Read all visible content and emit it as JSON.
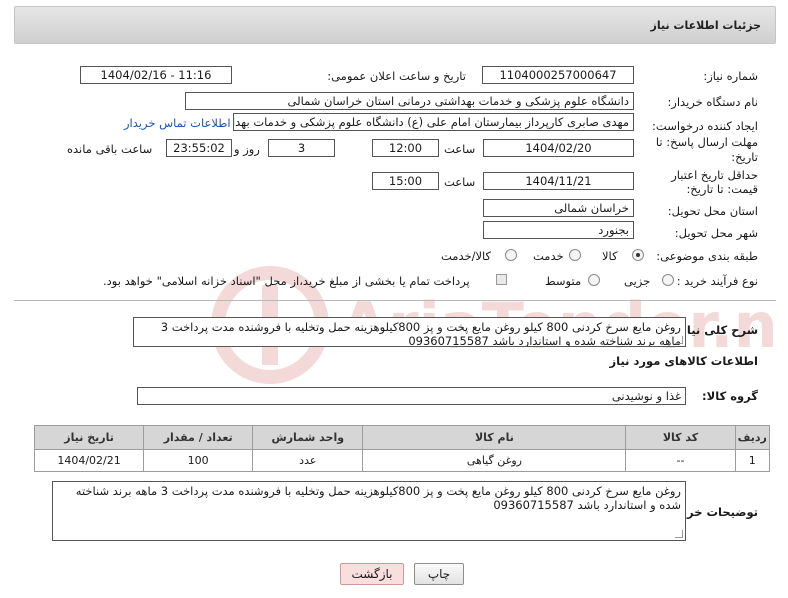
{
  "header": {
    "title": "جزئیات اطلاعات نیاز"
  },
  "form": {
    "need_number_label": "شماره نیاز:",
    "need_number": "1104000257000647",
    "announce_label": "تاریخ و ساعت اعلان عمومی:",
    "announce_value": "1404/02/16 - 11:16",
    "buyer_org_label": "نام دستگاه خریدار:",
    "buyer_org": "دانشگاه علوم پزشکی و خدمات بهداشتی درمانی استان خراسان شمالی",
    "creator_label": "ایجاد کننده درخواست:",
    "creator": "مهدی صابری کارپرداز بیمارستان امام علی (ع) دانشگاه علوم پزشکی و خدمات بهداشتی درمانی",
    "contact_link": "اطلاعات تماس خریدار",
    "reply_deadline_label": "مهلت ارسال پاسخ: تا تاریخ:",
    "reply_date": "1404/02/20",
    "time_label": "ساعت",
    "reply_time": "12:00",
    "days_value": "3",
    "days_label": "روز و",
    "remaining_time": "23:55:02",
    "remaining_label": "ساعت باقی مانده",
    "price_validity_label": "حداقل تاریخ اعتبار قیمت: تا تاریخ:",
    "price_date": "1404/11/21",
    "price_time": "15:00",
    "province_label": "استان محل تحویل:",
    "province": "خراسان شمالی",
    "city_label": "شهر محل تحویل:",
    "city": "بجنورد",
    "category_label": "طبقه بندی موضوعی:",
    "category_options": [
      "کالا",
      "خدمت",
      "کالا/خدمت"
    ],
    "process_label": "نوع فرآیند خرید :",
    "process_options": [
      "جزیی",
      "متوسط"
    ],
    "payment_note": "پرداخت تمام یا بخشی از مبلغ خرید،از محل \"اسناد خزانه اسلامی\" خواهد بود."
  },
  "description": {
    "label": "شرح کلی نیاز:",
    "text": "روغن مایع سرخ کردنی 800 کیلو روغن مایع پخت و پز 800کیلوهزینه حمل وتخلیه با فروشنده مدت پرداخت 3 ماهه برند  شناخته شده و استاندارد  باشد 09360715587"
  },
  "goods": {
    "section_title": "اطلاعات کالاهای مورد نیاز",
    "group_label": "گروه کالا:",
    "group_value": "غذا و نوشیدنی",
    "table": {
      "headers": [
        "ردیف",
        "کد کالا",
        "نام کالا",
        "واحد شمارش",
        "تعداد / مقدار",
        "تاریخ نیاز"
      ],
      "rows": [
        [
          "1",
          "--",
          "روغن گیاهی",
          "عدد",
          "100",
          "1404/02/21"
        ]
      ]
    }
  },
  "buyer_notes": {
    "label": "توضیحات خریدار:",
    "text": "روغن مایع سرخ کردنی 800 کیلو روغن مایع پخت و پز 800کیلوهزینه حمل وتخلیه با فروشنده مدت پرداخت 3 ماهه برند شناخته شده و استاندارد  باشد 09360715587"
  },
  "buttons": {
    "print": "چاپ",
    "back": "بازگشت"
  },
  "watermark": {
    "text": "AriaTender.neT"
  },
  "colors": {
    "header_bg": "#d9d9d9",
    "link": "#1a54b8",
    "back_button_bg": "#f9dede",
    "watermark": "#c0392b"
  }
}
